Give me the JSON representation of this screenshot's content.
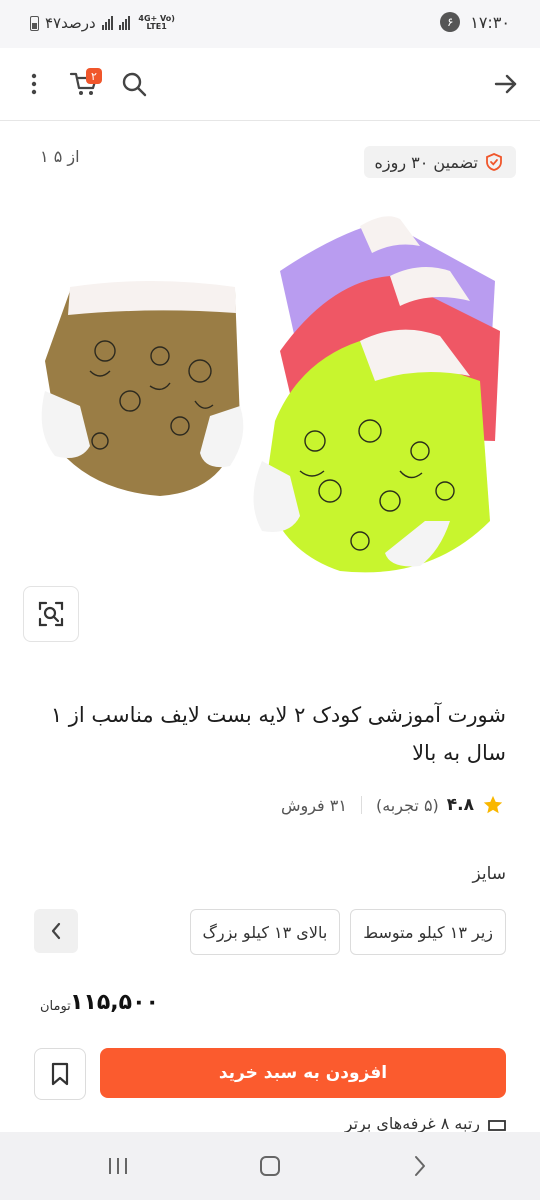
{
  "status_bar": {
    "time": "۱۷:۳۰",
    "notification_count": "۶",
    "battery_text": "۴۷درصد",
    "network": "4G+ Vo) LTE1"
  },
  "header": {
    "cart_count": "۲",
    "icons": [
      "back-arrow-icon",
      "search-icon",
      "cart-icon",
      "more-vertical-icon"
    ]
  },
  "gallery": {
    "counter": "۱ از ۵",
    "guarantee_label": "تضمین ۳۰ روزه"
  },
  "product": {
    "title": "شورت آموزشی کودک ۲ لایه بست لایف مناسب از ۱ سال به بالا",
    "rating": "۴.۸",
    "reviews": "(۵ تجربه)",
    "sales": "۳۱ فروش"
  },
  "size": {
    "label": "سایز",
    "options": [
      "زیر ۱۳ کیلو متوسط",
      "بالای ۱۳ کیلو بزرگ"
    ]
  },
  "price": {
    "value": "۱۱۵,۵۰۰",
    "currency": "تومان"
  },
  "actions": {
    "add_to_cart": "افزودن به سبد خرید"
  },
  "more": {
    "text": "رتبه ۸ غرفه‌های برتر"
  },
  "colors": {
    "accent": "#fb5b2e",
    "badge": "#f0562b",
    "star": "#f9b700"
  }
}
